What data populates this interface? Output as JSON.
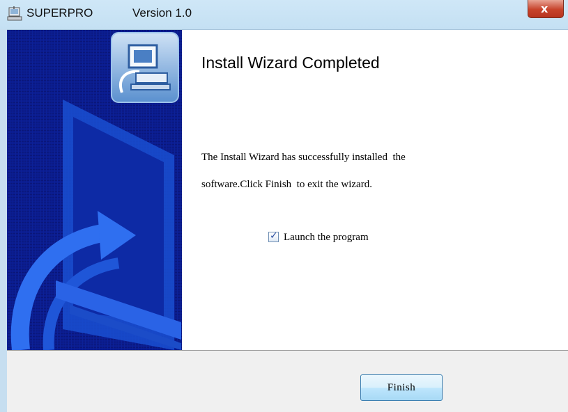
{
  "window": {
    "app_name": "SUPERPRO",
    "version": "Version 1.0",
    "icon": "installer-icon",
    "close_label": "x"
  },
  "banner": {
    "icon": "computer-icon"
  },
  "content": {
    "heading": "Install Wizard Completed",
    "message_line1": "The Install Wizard has successfully installed  the",
    "message_line2": "software.Click Finish  to exit the wizard.",
    "launch_checkbox": {
      "label": "Launch the program",
      "checked": true
    }
  },
  "footer": {
    "finish_label": "Finish"
  },
  "colors": {
    "banner_blue": "#0a1a8a",
    "titlebar": "#c4e0f3",
    "close_red": "#c7432b"
  }
}
